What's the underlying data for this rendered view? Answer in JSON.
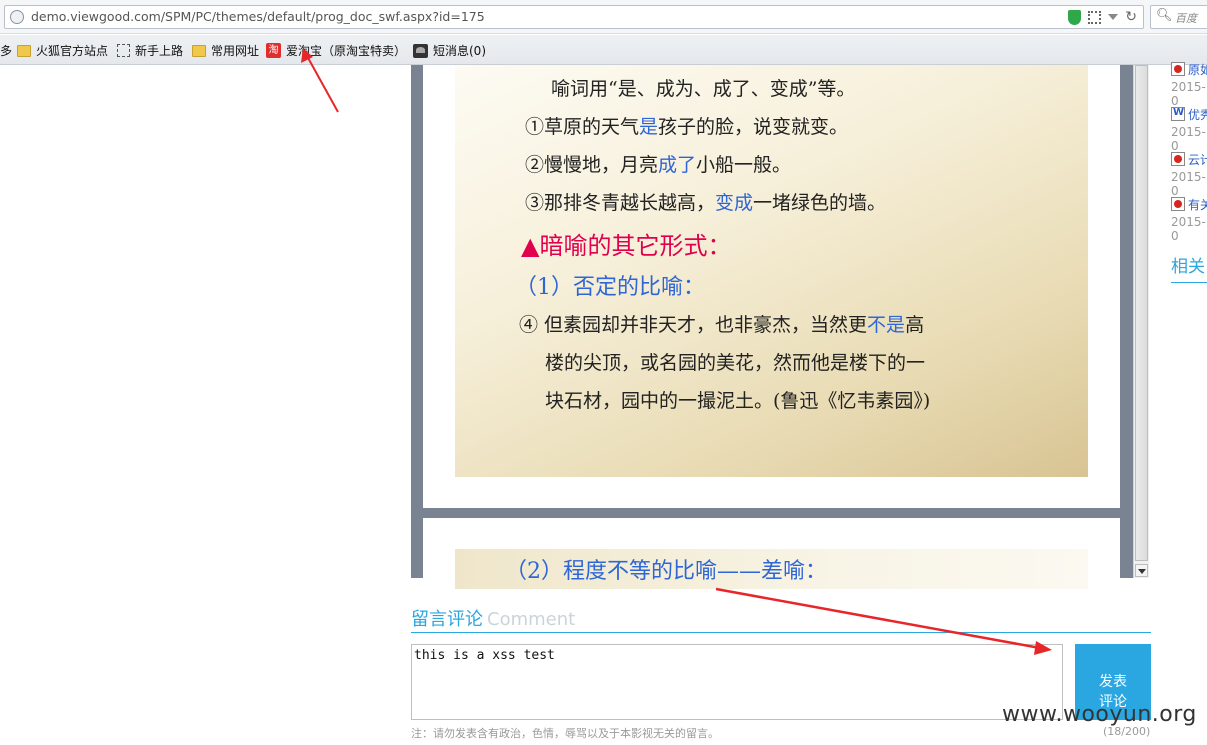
{
  "browser": {
    "url": "demo.viewgood.com/SPM/PC/themes/default/prog_doc_swf.aspx?id=175",
    "search_engine": "百度",
    "bookmarks": [
      {
        "label": "多"
      },
      {
        "label": "火狐官方站点"
      },
      {
        "label": "新手上路"
      },
      {
        "label": "常用网址"
      },
      {
        "label": "爱淘宝（原淘宝特卖）",
        "badge": "淘"
      },
      {
        "label": "短消息(0)"
      }
    ]
  },
  "document": {
    "page1_lines": [
      {
        "text": "喻词用“是、成为、成了、变成”等。"
      },
      {
        "pre": "①草原的天气",
        "hl": "是",
        "post": "孩子的脸，说变就变。"
      },
      {
        "pre": "②慢慢地，月亮",
        "hl": "成了",
        "post": "小船一般。"
      },
      {
        "pre": "③那排冬青越长越高，",
        "hl": "变成",
        "post": "一堵绿色的墙。"
      },
      {
        "text": "▲暗喻的其它形式："
      },
      {
        "text": "（1）否定的比喻："
      },
      {
        "pre": "④ 但素园却并非天才，也非豪杰，当然更",
        "hl": "不是",
        "post": "高"
      },
      {
        "text": "楼的尖顶，或名园的美花，然而他是楼下的一"
      },
      {
        "text": "块石材，园中的一撮泥土。(鲁迅《忆韦素园》)"
      }
    ],
    "page2_line": "（2）程度不等的比喻——差喻："
  },
  "sidebar": {
    "items": [
      {
        "title": "原如",
        "date": "2015-0",
        "icon": "pdf"
      },
      {
        "title": "优秀",
        "date": "2015-0",
        "icon": "doc"
      },
      {
        "title": "云计",
        "date": "2015-0",
        "icon": "pdf"
      },
      {
        "title": "有关",
        "date": "2015-0",
        "icon": "pdf"
      }
    ],
    "related": "相关"
  },
  "comment": {
    "title_cn": "留言评论",
    "title_en": "Comment",
    "value": "this is a xss test",
    "submit": "发表\n评论",
    "note": "注：请勿发表含有政治，色情，辱骂以及于本影视无关的留言。",
    "count": "(18/200)"
  },
  "watermark": "www.wooyun.org",
  "colors": {
    "accent": "#2aa7e0",
    "highlight_blue": "#2f66d6",
    "highlight_red": "#e0004d",
    "arrow": "#e8262a"
  }
}
